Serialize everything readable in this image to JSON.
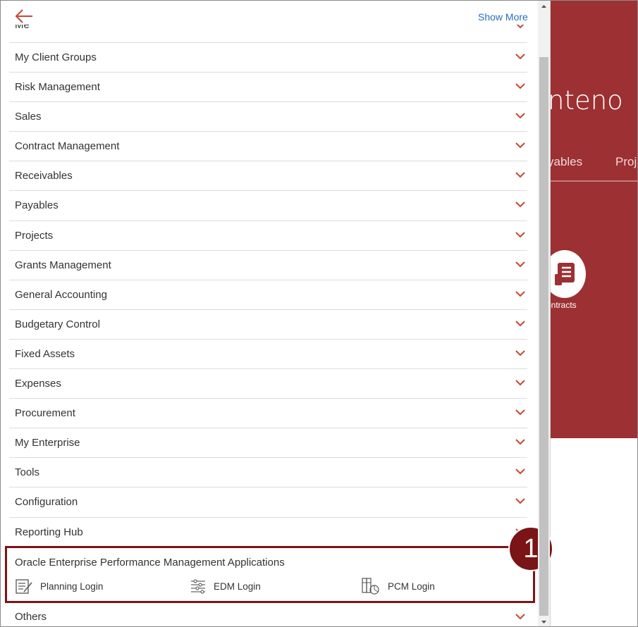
{
  "header": {
    "show_more_label": "Show More"
  },
  "navigator": {
    "partial_item_label": "Me",
    "items": [
      {
        "label": "My Client Groups"
      },
      {
        "label": "Risk Management"
      },
      {
        "label": "Sales"
      },
      {
        "label": "Contract Management"
      },
      {
        "label": "Receivables"
      },
      {
        "label": "Payables"
      },
      {
        "label": "Projects"
      },
      {
        "label": "Grants Management"
      },
      {
        "label": "General Accounting"
      },
      {
        "label": "Budgetary Control"
      },
      {
        "label": "Fixed Assets"
      },
      {
        "label": "Expenses"
      },
      {
        "label": "Procurement"
      },
      {
        "label": "My Enterprise"
      },
      {
        "label": "Tools"
      },
      {
        "label": "Configuration"
      },
      {
        "label": "Reporting Hub"
      }
    ],
    "epm_group": {
      "title": "Oracle Enterprise Performance Management Applications",
      "links": [
        {
          "label": "Planning Login",
          "icon": "document-edit-icon"
        },
        {
          "label": "EDM Login",
          "icon": "sliders-icon"
        },
        {
          "label": "PCM Login",
          "icon": "pcm-icon"
        }
      ]
    },
    "others_label": "Others"
  },
  "callout": {
    "number": "1"
  },
  "background_app": {
    "title_fragment": "nteno",
    "tab_fragment_1": "yables",
    "tab_fragment_2": "Proje",
    "tile_label_fragment": "ontracts"
  },
  "colors": {
    "accent_orange": "#c74634",
    "link_blue": "#2a6ebb",
    "banner_red": "#9c3033",
    "callout_maroon": "#7a1417"
  }
}
